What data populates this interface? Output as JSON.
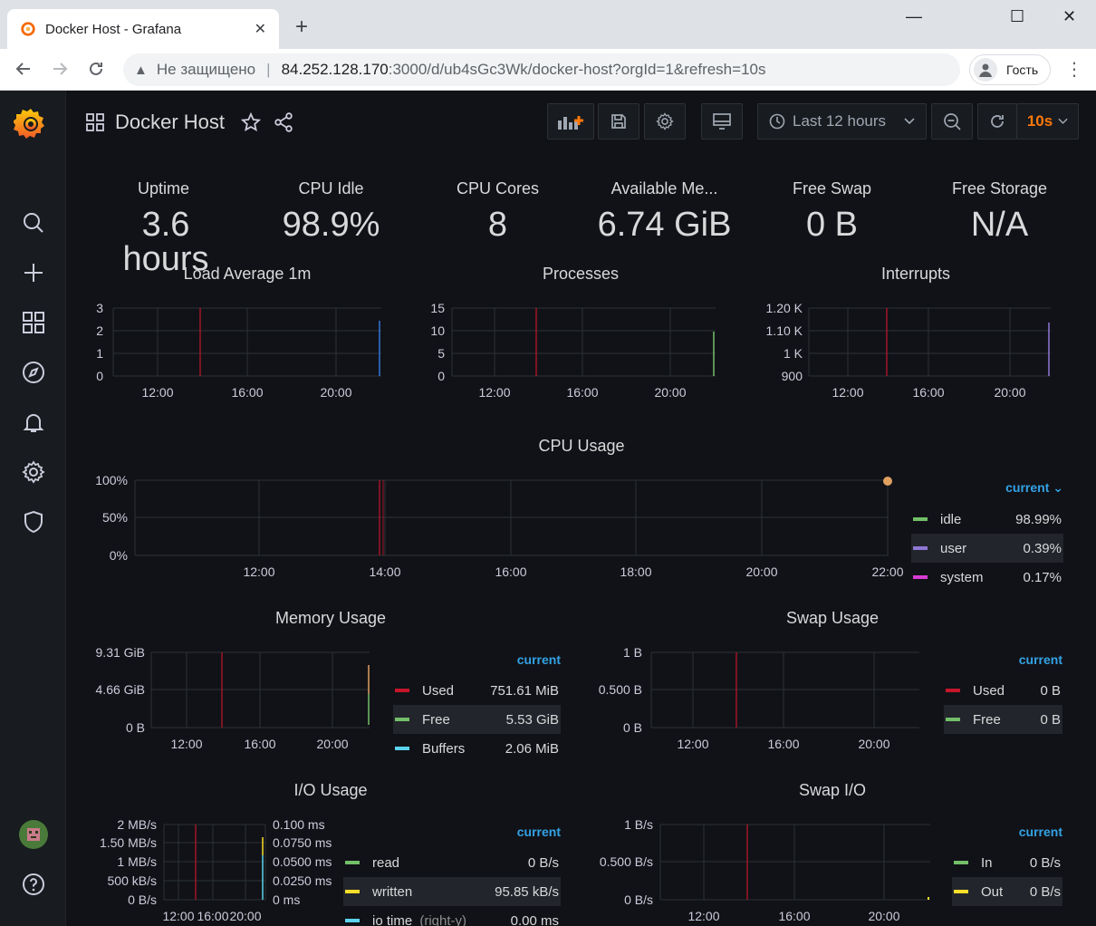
{
  "browser": {
    "tab_title": "Docker Host - Grafana",
    "tab_close": "✕",
    "new_tab": "+",
    "win_min": "—",
    "win_max": "☐",
    "win_close": "✕",
    "insecure_label": "Не защищено",
    "url_host": "84.252.128.170",
    "url_path": ":3000/d/ub4sGc3Wk/docker-host?orgId=1&refresh=10s",
    "profile_label": "Гость"
  },
  "dashboard": {
    "title": "Docker Host",
    "time_range": "Last 12 hours",
    "refresh": "10s"
  },
  "colors": {
    "accent_orange": "#ff780a",
    "legend_header": "#33a2e5",
    "red": "#c4162a",
    "green": "#73bf69",
    "purple": "#8f77d6",
    "magenta": "#d83bd3",
    "cyan": "#5cd3ee",
    "yellow": "#fade2a",
    "blue": "#3274d9"
  },
  "stats": [
    {
      "label": "Uptime",
      "value": "3.6 hours"
    },
    {
      "label": "CPU Idle",
      "value": "98.9%"
    },
    {
      "label": "CPU Cores",
      "value": "8"
    },
    {
      "label": "Available Me...",
      "value": "6.74 GiB"
    },
    {
      "label": "Free Swap",
      "value": "0 B"
    },
    {
      "label": "Free Storage",
      "value": "N/A"
    }
  ],
  "panels": {
    "load": {
      "title": "Load Average 1m",
      "yticks": [
        "3",
        "2",
        "1",
        "0"
      ],
      "xticks": [
        "12:00",
        "16:00",
        "20:00"
      ]
    },
    "processes": {
      "title": "Processes",
      "yticks": [
        "15",
        "10",
        "5",
        "0"
      ],
      "xticks": [
        "12:00",
        "16:00",
        "20:00"
      ]
    },
    "interrupts": {
      "title": "Interrupts",
      "yticks": [
        "1.20 K",
        "1.10 K",
        "1 K",
        "900"
      ],
      "xticks": [
        "12:00",
        "16:00",
        "20:00"
      ]
    },
    "cpu": {
      "title": "CPU Usage",
      "yticks": [
        "100%",
        "50%",
        "0%"
      ],
      "xticks": [
        "12:00",
        "14:00",
        "16:00",
        "18:00",
        "20:00",
        "22:00"
      ],
      "legend_header": "current ⌄",
      "legend": [
        {
          "name": "idle",
          "value": "98.99%",
          "color": "#73bf69"
        },
        {
          "name": "user",
          "value": "0.39%",
          "color": "#8f77d6"
        },
        {
          "name": "system",
          "value": "0.17%",
          "color": "#d83bd3"
        }
      ]
    },
    "memory": {
      "title": "Memory Usage",
      "yticks": [
        "9.31 GiB",
        "4.66 GiB",
        "0 B"
      ],
      "xticks": [
        "12:00",
        "16:00",
        "20:00"
      ],
      "legend_header": "current",
      "legend": [
        {
          "name": "Used",
          "value": "751.61 MiB",
          "color": "#c4162a"
        },
        {
          "name": "Free",
          "value": "5.53 GiB",
          "color": "#73bf69"
        },
        {
          "name": "Buffers",
          "value": "2.06 MiB",
          "color": "#5cd3ee"
        }
      ]
    },
    "swap": {
      "title": "Swap Usage",
      "yticks": [
        "1 B",
        "0.500 B",
        "0 B"
      ],
      "xticks": [
        "12:00",
        "16:00",
        "20:00"
      ],
      "legend_header": "current",
      "legend": [
        {
          "name": "Used",
          "value": "0 B",
          "color": "#c4162a"
        },
        {
          "name": "Free",
          "value": "0 B",
          "color": "#73bf69"
        }
      ]
    },
    "io": {
      "title": "I/O Usage",
      "yticks": [
        "2 MB/s",
        "1.50 MB/s",
        "1 MB/s",
        "500 kB/s",
        "0 B/s"
      ],
      "yticks_right": [
        "0.100 ms",
        "0.0750 ms",
        "0.0500 ms",
        "0.0250 ms",
        "0 ms"
      ],
      "xticks": [
        "12:00",
        "16:00",
        "20:00"
      ],
      "legend_header": "current",
      "legend": [
        {
          "name": "read",
          "value": "0 B/s",
          "color": "#73bf69",
          "suffix": ""
        },
        {
          "name": "written",
          "value": "95.85 kB/s",
          "color": "#fade2a",
          "suffix": ""
        },
        {
          "name": "io time",
          "value": "0.00 ms",
          "color": "#5cd3ee",
          "suffix": "(right-y)"
        }
      ]
    },
    "swapio": {
      "title": "Swap I/O",
      "yticks": [
        "1 B/s",
        "0.500 B/s",
        "0 B/s"
      ],
      "xticks": [
        "12:00",
        "16:00",
        "20:00"
      ],
      "legend_header": "current",
      "legend": [
        {
          "name": "In",
          "value": "0 B/s",
          "color": "#73bf69"
        },
        {
          "name": "Out",
          "value": "0 B/s",
          "color": "#fade2a"
        }
      ]
    }
  }
}
